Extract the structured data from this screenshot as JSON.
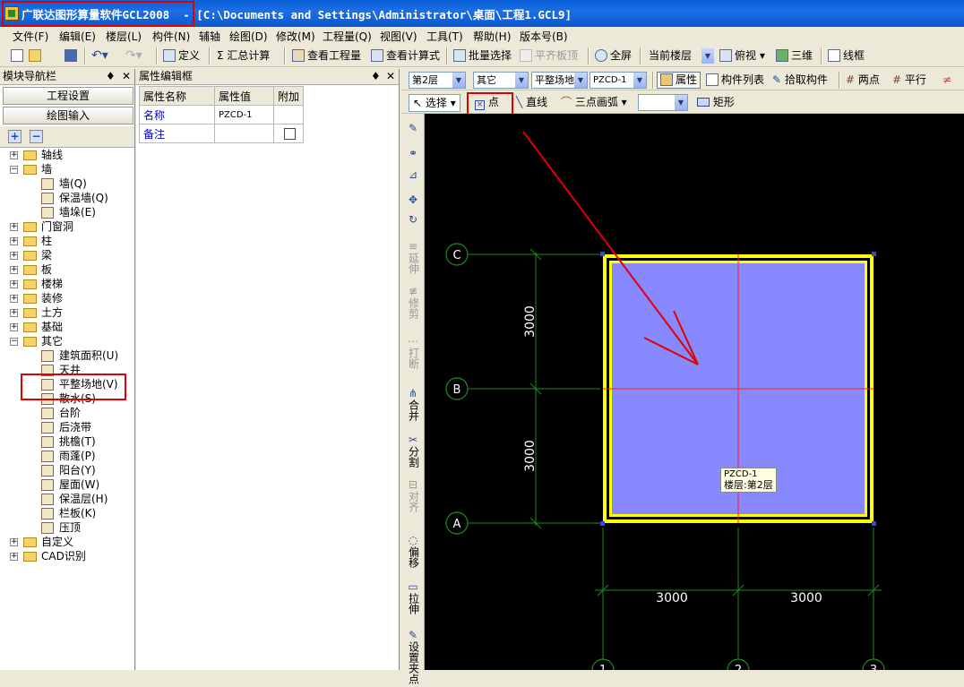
{
  "window": {
    "title": "广联达图形算量软件GCL2008  - [C:\\Documents and Settings\\Administrator\\桌面\\工程1.GCL9]"
  },
  "menu": [
    "文件(F)",
    "编辑(E)",
    "楼层(L)",
    "构件(N)",
    "辅轴",
    "绘图(D)",
    "修改(M)",
    "工程量(Q)",
    "视图(V)",
    "工具(T)",
    "帮助(H)",
    "版本号(B)"
  ],
  "toolbar1": {
    "define": "定义",
    "sum": "Σ 汇总计算",
    "view_qty": "查看工程量",
    "view_formula": "查看计算式",
    "batch_select": "批量选择",
    "align_slab": "平齐板顶",
    "fullscreen": "全屏",
    "floor_combo": "当前楼层",
    "top_view": "俯视",
    "threed": "三维",
    "wireframe": "线框"
  },
  "nav_panel": {
    "title": "模块导航栏",
    "project_settings": "工程设置",
    "drawing_input": "绘图输入",
    "tree": [
      {
        "label": "轴线",
        "level": 0,
        "expanded": false
      },
      {
        "label": "墙",
        "level": 0,
        "expanded": true
      },
      {
        "label": "墙(Q)",
        "level": 1
      },
      {
        "label": "保温墙(Q)",
        "level": 1
      },
      {
        "label": "墙垛(E)",
        "level": 1
      },
      {
        "label": "门窗洞",
        "level": 0,
        "expanded": false
      },
      {
        "label": "柱",
        "level": 0,
        "expanded": false
      },
      {
        "label": "梁",
        "level": 0,
        "expanded": false
      },
      {
        "label": "板",
        "level": 0,
        "expanded": false
      },
      {
        "label": "楼梯",
        "level": 0,
        "expanded": false
      },
      {
        "label": "装修",
        "level": 0,
        "expanded": false
      },
      {
        "label": "土方",
        "level": 0,
        "expanded": false
      },
      {
        "label": "基础",
        "level": 0,
        "expanded": false
      },
      {
        "label": "其它",
        "level": 0,
        "expanded": true
      },
      {
        "label": "建筑面积(U)",
        "level": 1
      },
      {
        "label": "天井",
        "level": 1
      },
      {
        "label": "平整场地(V)",
        "level": 1,
        "selected": true
      },
      {
        "label": "散水(S)",
        "level": 1
      },
      {
        "label": "台阶",
        "level": 1
      },
      {
        "label": "后浇带",
        "level": 1
      },
      {
        "label": "挑檐(T)",
        "level": 1
      },
      {
        "label": "雨蓬(P)",
        "level": 1
      },
      {
        "label": "阳台(Y)",
        "level": 1
      },
      {
        "label": "屋面(W)",
        "level": 1
      },
      {
        "label": "保温层(H)",
        "level": 1
      },
      {
        "label": "栏板(K)",
        "level": 1
      },
      {
        "label": "压顶",
        "level": 1
      },
      {
        "label": "自定义",
        "level": 0,
        "expanded": false
      },
      {
        "label": "CAD识别",
        "level": 0,
        "expanded": false
      }
    ]
  },
  "prop_panel": {
    "title": "属性编辑框",
    "headers": [
      "属性名称",
      "属性值",
      "附加"
    ],
    "rows": [
      {
        "name": "名称",
        "value": "PZCD-1"
      },
      {
        "name": "备注",
        "value": ""
      }
    ]
  },
  "toolbar2": {
    "floor": "第2层",
    "category": "其它",
    "type": "平整场地",
    "component": "PZCD-1",
    "properties": "属性",
    "component_list": "构件列表",
    "pick_component": "拾取构件",
    "two_points": "两点",
    "parallel": "平行"
  },
  "toolbar3": {
    "select": "选择",
    "point": "点",
    "line": "直线",
    "arc": "三点画弧",
    "rectangle": "矩形"
  },
  "vtoolbar": [
    "延伸",
    "修剪",
    "打断",
    "合并",
    "分割",
    "对齐",
    "偏移",
    "拉伸",
    "设置夹点"
  ],
  "canvas": {
    "axis_rows": [
      "C",
      "B",
      "A"
    ],
    "axis_cols": [
      "1",
      "2",
      "3"
    ],
    "dim_vertical": [
      "3000",
      "3000"
    ],
    "dim_horizontal": [
      "3000",
      "3000"
    ],
    "tooltip_name": "PZCD-1",
    "tooltip_floor": "楼层:第2层"
  },
  "colors": {
    "highlight": "#e00000",
    "fill": "#8888ff",
    "border": "#ffff00",
    "grid": "#00aa00",
    "axis": "#ff0000"
  }
}
